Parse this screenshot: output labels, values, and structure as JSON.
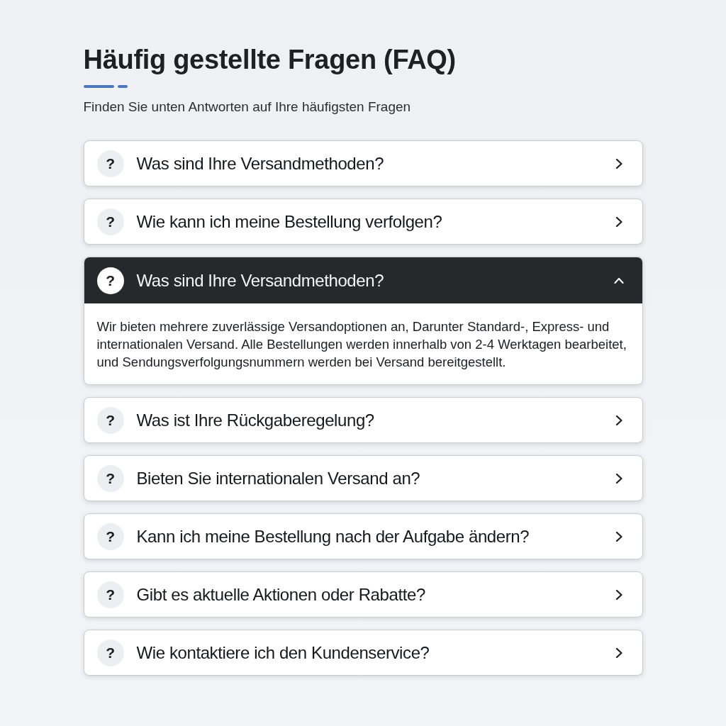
{
  "header": {
    "title": "Häufig gestellte Fragen (FAQ)",
    "subtitle": "Finden Sie unten Antworten auf Ihre häufigsten Fragen"
  },
  "items": [
    {
      "icon": "?",
      "question": "Was sind Ihre Versandmethoden?",
      "expanded": false
    },
    {
      "icon": "?",
      "question": "Wie kann ich meine Bestellung verfolgen?",
      "expanded": false
    },
    {
      "icon": "?",
      "question": "Was sind Ihre Versandmethoden?",
      "expanded": true,
      "answer": "Wir bieten mehrere zuverlässige Versandoptionen an, Darunter Standard-, Express- und internationalen Versand. Alle Bestellungen werden innerhalb von 2-4 Werktagen bearbeitet, und Sendungsverfolgungsnummern werden bei Versand bereitgestellt."
    },
    {
      "icon": "?",
      "question": "Was ist Ihre Rückgaberegelung?",
      "expanded": false
    },
    {
      "icon": "?",
      "question": "Bieten Sie internationalen Versand an?",
      "expanded": false
    },
    {
      "icon": "?",
      "question": "Kann ich meine Bestellung nach der Aufgabe ändern?",
      "expanded": false
    },
    {
      "icon": "?",
      "question": "Gibt es aktuelle Aktionen oder Rabatte?",
      "expanded": false
    },
    {
      "icon": "?",
      "question": "Wie kontaktiere ich den Kundenservice?",
      "expanded": false
    }
  ]
}
